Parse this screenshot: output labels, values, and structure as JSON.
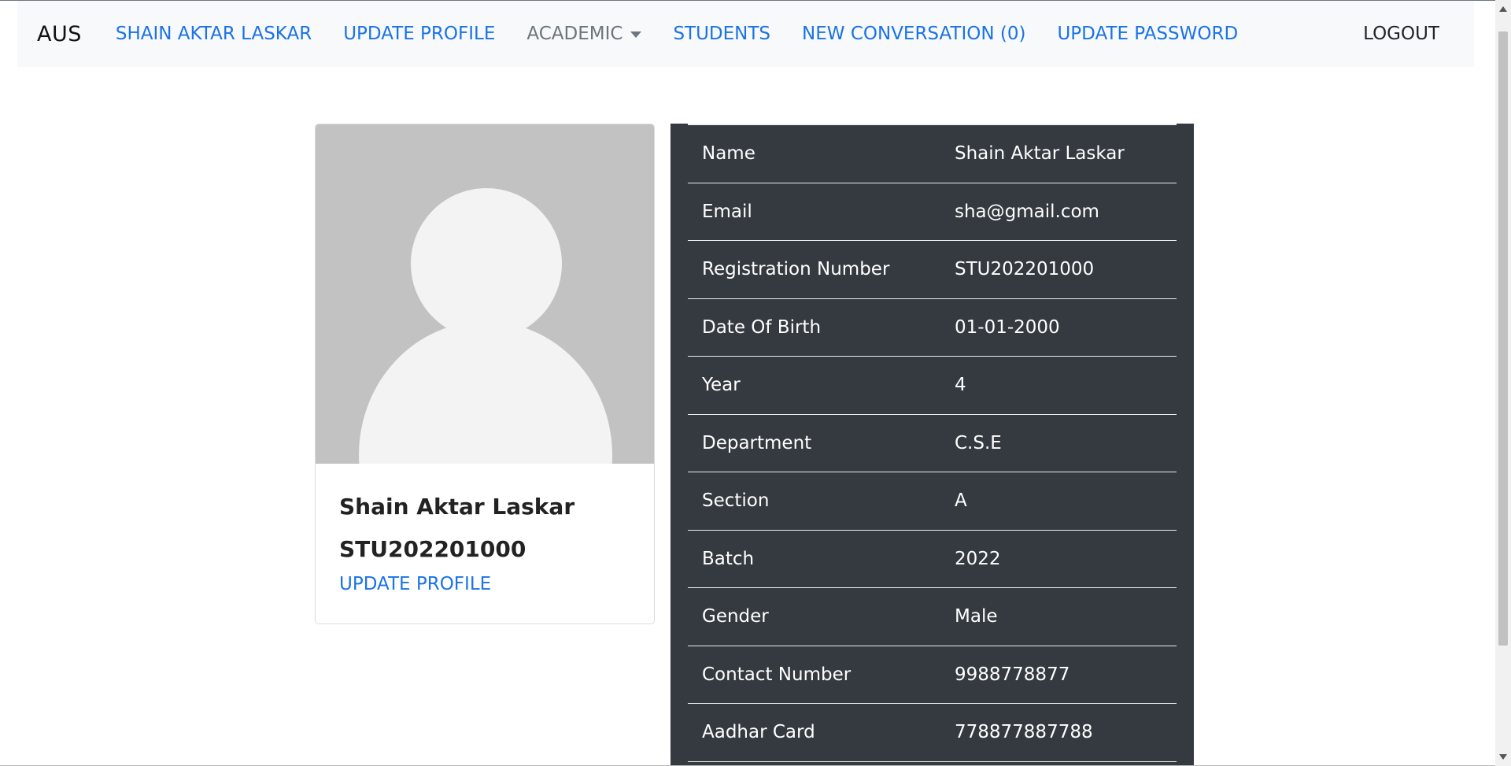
{
  "navbar": {
    "brand": "AUS",
    "links": [
      {
        "label": "SHAIN AKTAR LASKAR"
      },
      {
        "label": "UPDATE PROFILE"
      },
      {
        "label": "ACADEMIC"
      },
      {
        "label": "STUDENTS"
      },
      {
        "label": "NEW CONVERSATION (0)"
      },
      {
        "label": "UPDATE PASSWORD"
      }
    ],
    "logout": "LOGOUT"
  },
  "profile_card": {
    "name": "Shain Aktar Laskar",
    "registration": "STU202201000",
    "update_link": "UPDATE PROFILE",
    "avatar_icon": "user-placeholder-icon"
  },
  "details": {
    "rows": [
      {
        "label": "Name",
        "value": "Shain Aktar Laskar"
      },
      {
        "label": "Email",
        "value": "sha@gmail.com"
      },
      {
        "label": "Registration Number",
        "value": "STU202201000"
      },
      {
        "label": "Date Of Birth",
        "value": "01-01-2000"
      },
      {
        "label": "Year",
        "value": "4"
      },
      {
        "label": "Department",
        "value": "C.S.E"
      },
      {
        "label": "Section",
        "value": "A"
      },
      {
        "label": "Batch",
        "value": "2022"
      },
      {
        "label": "Gender",
        "value": "Male"
      },
      {
        "label": "Contact Number",
        "value": "9988778877"
      },
      {
        "label": "Aadhar Card",
        "value": "778877887788"
      }
    ]
  },
  "colors": {
    "link": "#1a73e8",
    "navbar_bg": "#f8f9fa",
    "table_bg": "#343a40",
    "avatar_bg": "#c2c2c2"
  }
}
